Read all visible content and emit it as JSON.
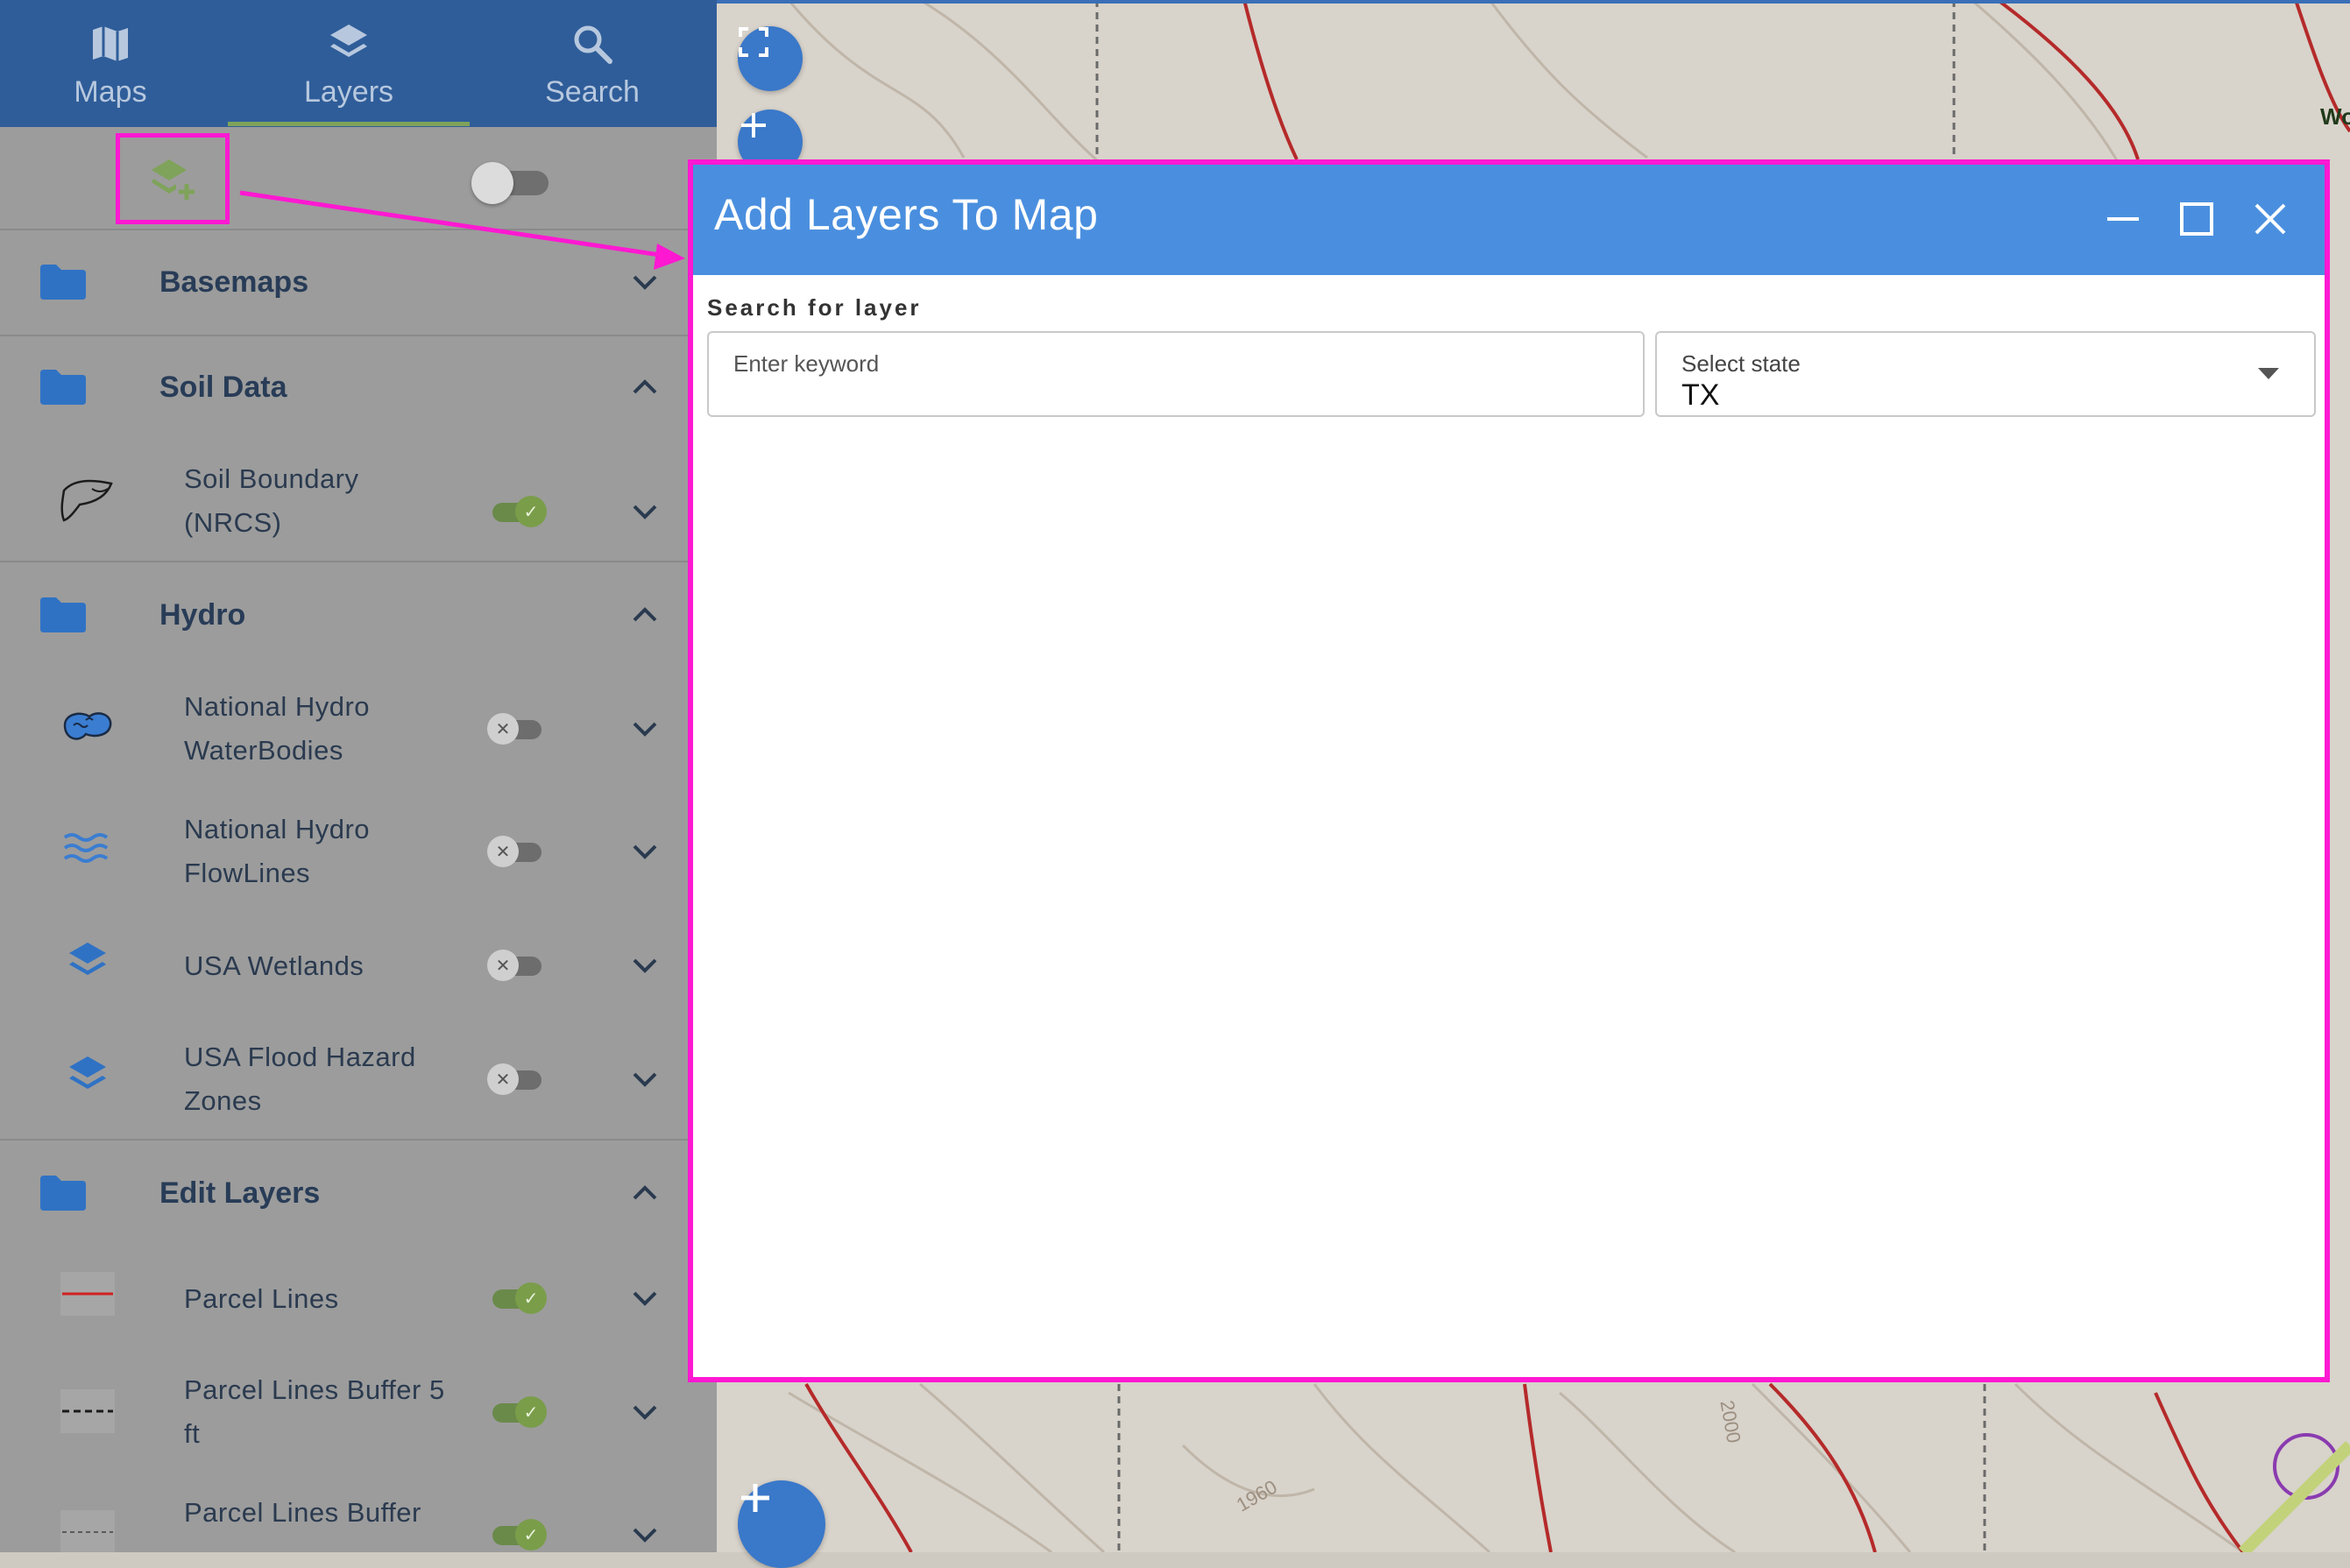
{
  "colors": {
    "nav_bg": "#2f5d99",
    "sidebar_bg": "#9c9c9c",
    "accent_green": "#7fa35a",
    "dialog_header": "#4a8fdf",
    "highlight_magenta": "#ff18d2",
    "map_button": "#3a78c9"
  },
  "nav": {
    "tabs": [
      {
        "label": "Maps",
        "icon": "map-icon"
      },
      {
        "label": "Layers",
        "icon": "layers-icon",
        "active": true
      },
      {
        "label": "Search",
        "icon": "search-icon"
      }
    ]
  },
  "toolbar": {
    "add_layer_icon": "add-layer-icon",
    "visibility_toggle_on": false
  },
  "groups": [
    {
      "name": "Basemaps",
      "expanded": false,
      "layers": []
    },
    {
      "name": "Soil Data",
      "expanded": true,
      "layers": [
        {
          "name": "Soil Boundary (NRCS)",
          "icon": "soil-boundary-icon",
          "on": true
        }
      ]
    },
    {
      "name": "Hydro",
      "expanded": true,
      "layers": [
        {
          "name": "National Hydro WaterBodies",
          "icon": "waterbody-icon",
          "on": false
        },
        {
          "name": "National Hydro FlowLines",
          "icon": "flowlines-icon",
          "on": false
        },
        {
          "name": "USA Wetlands",
          "icon": "layers-icon",
          "on": false
        },
        {
          "name": "USA Flood Hazard Zones",
          "icon": "layers-icon",
          "on": false
        }
      ]
    },
    {
      "name": "Edit Layers",
      "expanded": true,
      "layers": [
        {
          "name": "Parcel Lines",
          "icon": "parcel-line-icon",
          "on": true
        },
        {
          "name": "Parcel Lines Buffer 5 ft",
          "icon": "dashed-line-icon",
          "on": true
        },
        {
          "name": "Parcel Lines Buffer",
          "icon": "dashed-line-icon",
          "on": true
        }
      ]
    }
  ],
  "dialog": {
    "title": "Add Layers To Map",
    "search_label": "Search for layer",
    "keyword_placeholder": "Enter keyword",
    "state_label": "Select state",
    "state_value": "TX"
  },
  "map": {
    "contour_labels": [
      "2000",
      "1960"
    ],
    "corner_label": "Wo"
  }
}
